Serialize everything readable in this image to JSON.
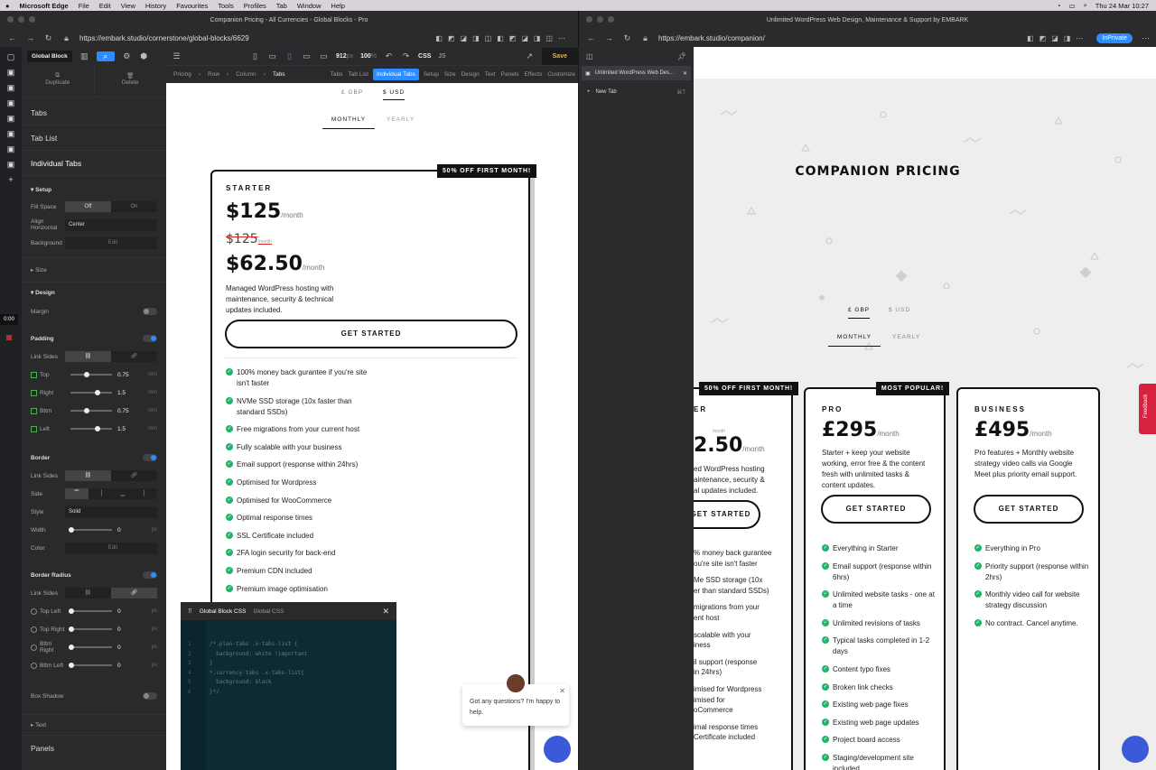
{
  "menubar": {
    "app": "Microsoft Edge",
    "items": [
      "File",
      "Edit",
      "View",
      "History",
      "Favourites",
      "Tools",
      "Profiles",
      "Tab",
      "Window",
      "Help"
    ],
    "clock": "Thu 24 Mar  10:27"
  },
  "left_window": {
    "title": "Companion Pricing - All Currencies - Global Blocks - Pro",
    "url": "https://embark.studio/cornerstone/global-blocks/6629"
  },
  "builder": {
    "block_name": "Global Block",
    "viewport_width": "912",
    "viewport_unit": "px",
    "zoom": "100",
    "zoom_unit": "%",
    "css_tab": "CSS",
    "js_tab": "JS",
    "save": "Save",
    "duplicate": "Duplicate",
    "delete": "Delete",
    "sections": [
      "Tabs",
      "Tab List",
      "Individual Tabs"
    ],
    "setup": {
      "title": "Setup",
      "fill_space": "Fill Space",
      "off": "Off",
      "on": "On",
      "align_label": "Align Horizontal",
      "align_value": "Center",
      "background": "Background",
      "edit": "Edit"
    },
    "size": "Size",
    "design": {
      "title": "Design",
      "margin": "Margin",
      "padding": "Padding",
      "link_sides": "Link Sides",
      "padding_rows": [
        {
          "label": "Top",
          "value": "0.75",
          "unit": "rem",
          "level": 0.4
        },
        {
          "label": "Right",
          "value": "1.5",
          "unit": "rem",
          "level": 0.65
        },
        {
          "label": "Bttm",
          "value": "0.75",
          "unit": "rem",
          "level": 0.4
        },
        {
          "label": "Left",
          "value": "1.5",
          "unit": "rem",
          "level": 0.65
        }
      ],
      "border": "Border",
      "side": "Side",
      "style": "Style",
      "style_value": "Solid",
      "width": "Width",
      "width_value": "0",
      "width_unit": "px",
      "color": "Color",
      "border_radius": "Border Radius",
      "radius_rows": [
        {
          "label": "Top Left",
          "value": "0",
          "unit": "px"
        },
        {
          "label": "Top Right",
          "value": "0",
          "unit": "px"
        },
        {
          "label": "Bttm Right",
          "value": "0",
          "unit": "px"
        },
        {
          "label": "Bttm Left",
          "value": "0",
          "unit": "px"
        }
      ],
      "box_shadow": "Box Shadow",
      "text": "Text",
      "panels": "Panels"
    },
    "breadcrumbs": [
      "Pricing",
      "Row",
      "Column",
      "Tabs"
    ],
    "top_tabs": [
      "Tabs",
      "Tab List",
      "Individual Tabs",
      "Setup",
      "Size",
      "Design",
      "Text",
      "Panels",
      "Effects",
      "Customize"
    ],
    "timer": "0:00"
  },
  "preview": {
    "currencies": [
      "£ GBP",
      "$ USD"
    ],
    "periods": [
      "MONTHLY",
      "YEARLY"
    ],
    "ribbon": "50% OFF FIRST MONTH!",
    "plan": "STARTER",
    "price": "$125",
    "per": "/month",
    "struck": "$125",
    "struck_per": "/month",
    "sale": "$62.50",
    "sale_per": "/month",
    "desc": "Managed WordPress hosting with maintenance, security & technical updates included.",
    "cta": "GET STARTED",
    "features": [
      "100% money back gurantee if you're site isn't faster",
      "NVMe SSD storage (10x faster than standard SSDs)",
      "Free migrations from your current host",
      "Fully scalable with your business",
      "Email support (response within 24hrs)",
      "Optimised for Wordpress",
      "Optimised for WooCommerce",
      "Optimal response times",
      "SSL Certificate included",
      "2FA login security for back-end",
      "Premium CDN included",
      "Premium image optimisation"
    ]
  },
  "css_panel": {
    "tabs": [
      "Global Block CSS",
      "Global CSS"
    ],
    "lines": [
      "/*.plan-tabs .x-tabs-list {",
      "  background: white !important",
      "}",
      "*.currency-tabs .x-tabs-list{",
      "  background: black",
      "}*/"
    ]
  },
  "chat_bubble": "Got any questions? I'm happy to help.",
  "right_window": {
    "title": "Unlimited WordPress Web Design, Maintenance & Support by EMBARK",
    "url": "https://embark.studio/companion/",
    "profile": "InPrivate",
    "side_tab": "Unlimited WordPress Web Des...",
    "new_tab": "New Tab",
    "new_tab_shortcut": "⌘T"
  },
  "site": {
    "heading": "COMPANION PRICING",
    "currencies": [
      "£ GBP",
      "$ USD"
    ],
    "periods": [
      "MONTHLY",
      "YEARLY"
    ],
    "feedback": "Feedback",
    "starter_partial": {
      "ribbon": "50% OFF FIRST MONTH!",
      "plan": "ER",
      "per_small": "month",
      "price": "2.50",
      "per": "/month",
      "desc": [
        "ed WordPress hosting",
        "aintenance, security &",
        "al updates included."
      ],
      "cta": "GET STARTED",
      "features": [
        "% money back gurantee",
        "ou're site isn't faster",
        "Me SSD storage (10x",
        "er than standard SSDs)",
        "migrations from your",
        "ent host",
        "scalable with your",
        "iness",
        "il support (response",
        "in 24hrs)",
        "imised for Wordpress",
        "imised for",
        "oCommerce",
        "imal response times",
        "Certificate included"
      ]
    },
    "pro": {
      "ribbon": "MOST POPULAR!",
      "plan": "PRO",
      "price": "£295",
      "per": "/month",
      "desc": "Starter + keep your website working, error free & the content fresh with unlimited tasks & content updates.",
      "cta": "GET STARTED",
      "features": [
        "Everything in Starter",
        "Email support (response within 6hrs)",
        "Unlimited website tasks - one at a time",
        "Unlimited revisions of tasks",
        "Typical tasks completed in 1-2 days",
        "Content typo fixes",
        "Broken link checks",
        "Existing web page fixes",
        "Existing web page updates",
        "Project board access",
        "Staging/development site included"
      ]
    },
    "business": {
      "plan": "BUSINESS",
      "price": "£495",
      "per": "/month",
      "desc": "Pro features + Monthly website strategy video calls via Google Meet plus priority email support.",
      "cta": "GET STARTED",
      "features": [
        "Everything in Pro",
        "Priority support (response within 2hrs)",
        "Monthly video call for website strategy discussion",
        "No contract. Cancel anytime."
      ]
    }
  }
}
